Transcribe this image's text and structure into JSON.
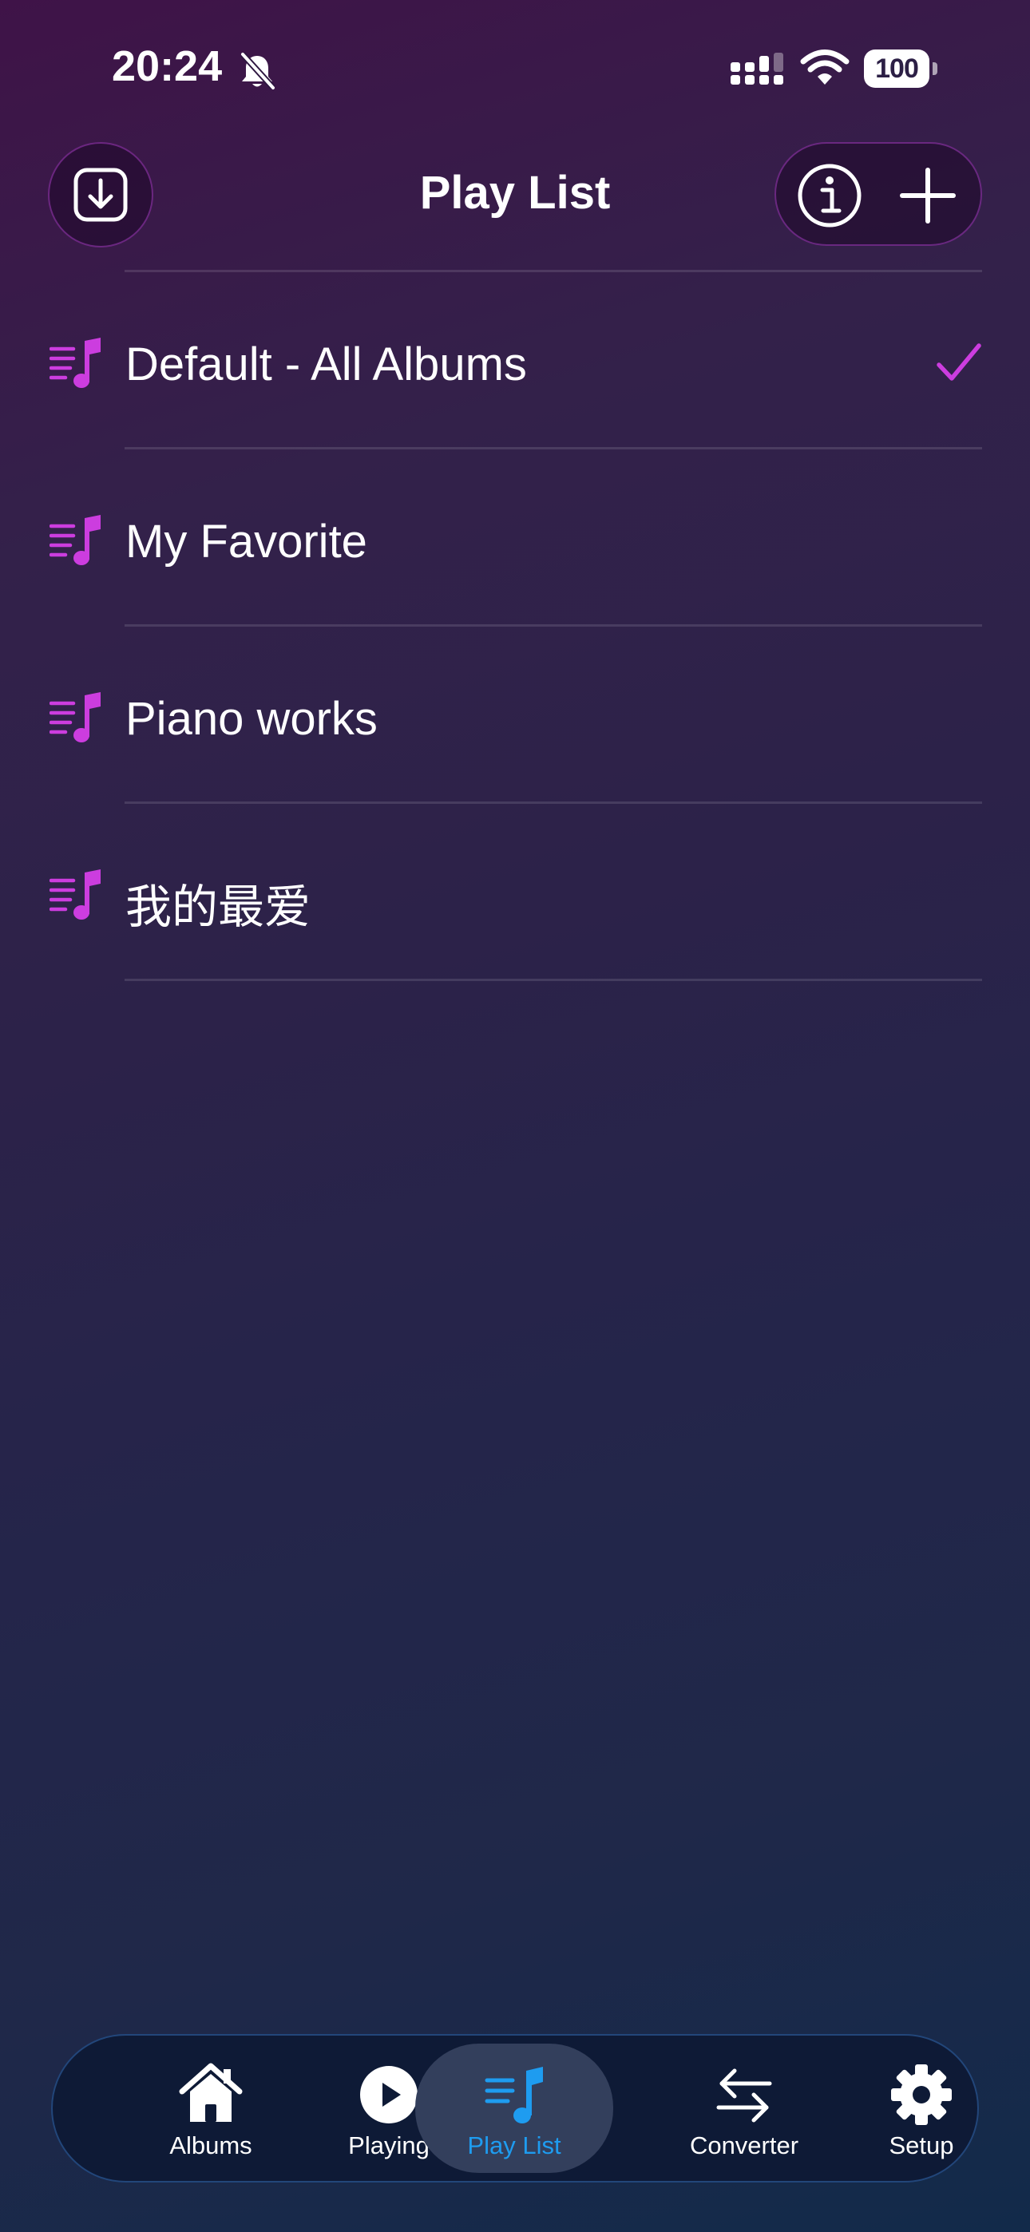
{
  "status_bar": {
    "time": "20:24",
    "battery": "100"
  },
  "header": {
    "title": "Play List"
  },
  "playlists": [
    {
      "label": "Default - All Albums",
      "selected": true
    },
    {
      "label": "My Favorite",
      "selected": false
    },
    {
      "label": "Piano works",
      "selected": false
    },
    {
      "label": "我的最爱",
      "selected": false
    }
  ],
  "tab_bar": {
    "tabs": [
      {
        "label": "Albums",
        "icon": "house-icon",
        "active": false
      },
      {
        "label": "Playing",
        "icon": "play-circle-icon",
        "active": false
      },
      {
        "label": "Play List",
        "icon": "music-list-icon",
        "active": true
      },
      {
        "label": "Converter",
        "icon": "arrows-swap-icon",
        "active": false
      },
      {
        "label": "Setup",
        "icon": "gear-icon",
        "active": false
      }
    ]
  },
  "colors": {
    "accent_magenta": "#cc3ddf",
    "accent_blue": "#1e9cf0",
    "tab_bar_background": "#0e1a36"
  }
}
